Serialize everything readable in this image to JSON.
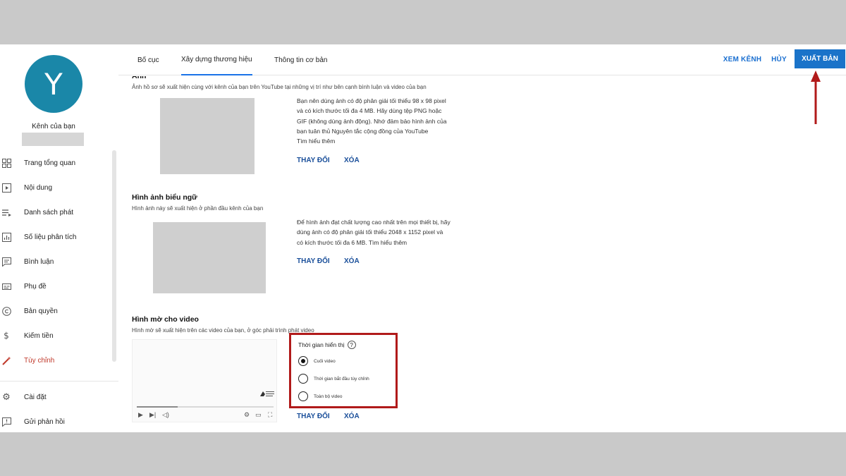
{
  "header": {
    "tabs": [
      {
        "label": "Bố cục"
      },
      {
        "label": "Xây dựng thương hiệu"
      },
      {
        "label": "Thông tin cơ bản"
      }
    ],
    "view_channel": "XEM KÊNH",
    "cancel": "HỦY",
    "publish": "XUẤT BẢN"
  },
  "sidebar": {
    "avatar_letter": "Y",
    "channel_label": "Kênh của bạn",
    "items": [
      {
        "label": "Trang tổng quan",
        "icon": "dashboard-icon"
      },
      {
        "label": "Nội dung",
        "icon": "content-icon"
      },
      {
        "label": "Danh sách phát",
        "icon": "playlist-icon"
      },
      {
        "label": "Số liệu phân tích",
        "icon": "analytics-icon"
      },
      {
        "label": "Bình luận",
        "icon": "comments-icon"
      },
      {
        "label": "Phụ đề",
        "icon": "subtitles-icon"
      },
      {
        "label": "Bản quyền",
        "icon": "copyright-icon"
      },
      {
        "label": "Kiếm tiền",
        "icon": "dollar-icon"
      },
      {
        "label": "Tùy chỉnh",
        "icon": "magic-wand-icon"
      },
      {
        "label": "Cài đặt",
        "icon": "gear-icon"
      },
      {
        "label": "Gửi phản hồi",
        "icon": "feedback-icon"
      }
    ],
    "accent_color": "#c0392b"
  },
  "sections": {
    "photo": {
      "title": "Ảnh",
      "description": "Ảnh hồ sơ sẽ xuất hiện cùng với kênh của bạn trên YouTube tại những vị trí như bên cạnh bình luận và video của bạn",
      "info_lines": [
        "Bạn nên dùng ảnh có độ phân giải tối thiểu 98 x 98 pixel",
        "và có kích thước tối đa 4 MB. Hãy dùng tệp PNG hoặc",
        "GIF (không dùng ảnh động). Nhớ đảm bảo hình ảnh của",
        "bạn tuân thủ Nguyên tắc cộng đồng của YouTube",
        "Tìm hiểu thêm"
      ],
      "change": "THAY ĐỔI",
      "remove": "XÓA"
    },
    "banner": {
      "title": "Hình ảnh biểu ngữ",
      "description": "Hình ảnh này sẽ xuất hiện ở phần đầu kênh của bạn",
      "info_lines": [
        "Để hình ảnh đạt chất lượng cao nhất trên mọi thiết bị, hãy",
        "dùng ảnh có độ phân giải tối thiểu 2048 x 1152 pixel và",
        "có kích thước tối đa 6 MB. Tìm hiểu thêm"
      ],
      "change": "THAY ĐỔI",
      "remove": "XÓA"
    },
    "watermark": {
      "title": "Hình mờ cho video",
      "description": "Hình mờ sẽ xuất hiện trên các video của bạn, ở góc phải trình phát video",
      "display_time_label": "Thời gian hiển thị",
      "help": "?",
      "options": [
        {
          "label": "Cuối video",
          "checked": true
        },
        {
          "label": "Thời gian bắt đầu tùy chỉnh",
          "checked": false
        },
        {
          "label": "Toàn bộ video",
          "checked": false
        }
      ],
      "change": "THAY ĐỔI",
      "remove": "XÓA",
      "highlight_color": "#b11a1a"
    }
  },
  "colors": {
    "publish_bg": "#1a73c9",
    "link": "#1a6fd0",
    "arrow": "#b11a1a"
  }
}
